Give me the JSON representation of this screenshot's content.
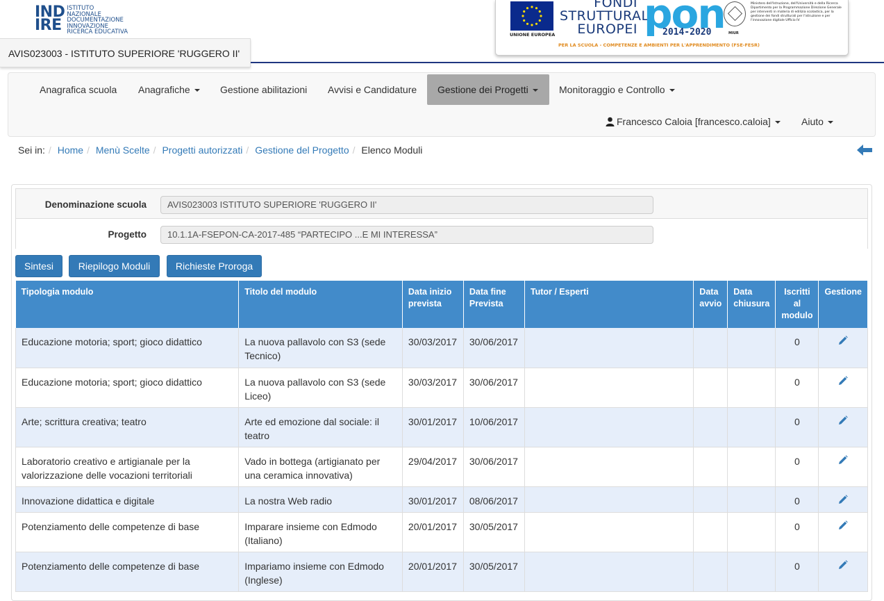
{
  "header": {
    "indire_mark_line1": "IND",
    "indire_mark_line2": "IRE",
    "indire_text": [
      "ISTITUTO",
      "NAZIONALE",
      "DOCUMENTAZIONE",
      "INNOVAZIONE",
      "RICERCA EDUCATIVA"
    ],
    "school_code_title": "AVIS023003 - ISTITUTO SUPERIORE 'RUGGERO II'",
    "eu_label": "UNIONE EUROPEA",
    "fondi_line1": "FONDI",
    "fondi_line2": "STRUTTURALI",
    "fondi_line3": "EUROPEI",
    "pon_word": "pon",
    "pon_years": "2014-2020",
    "miur_label": "MIUR",
    "miur_text": "Ministero dell'Istruzione, dell'Università e della Ricerca Dipartimento per la Programmazione Direzione Generale per interventi in materia di edilizia scolastica, per la gestione dei fondi strutturali per l'istruzione e per l'innovazione digitale Ufficio IV",
    "pon_footer": "PER LA SCUOLA - COMPETENZE E AMBIENTI PER L'APPRENDIMENTO (FSE-FESR)",
    "accent_color": "#1f3680"
  },
  "navbar": {
    "items": [
      {
        "label": "Anagrafica scuola",
        "dropdown": false
      },
      {
        "label": "Anagrafiche",
        "dropdown": true
      },
      {
        "label": "Gestione abilitazioni",
        "dropdown": false
      },
      {
        "label": "Avvisi e Candidature",
        "dropdown": false
      },
      {
        "label": "Gestione dei Progetti",
        "dropdown": true,
        "active": true
      },
      {
        "label": "Monitoraggio e Controllo",
        "dropdown": true
      }
    ],
    "user": "Francesco Caloia [francesco.caloia]",
    "help": "Aiuto"
  },
  "breadcrumb": {
    "prefix": "Sei in:",
    "links": [
      "Home",
      "Menù Scelte",
      "Progetti autorizzati",
      "Gestione del Progetto"
    ],
    "current": "Elenco Moduli"
  },
  "form": {
    "school_label": "Denominazione scuola",
    "school_value": "AVIS023003 ISTITUTO SUPERIORE 'RUGGERO II'",
    "project_label": "Progetto",
    "project_value": "10.1.1A-FSEPON-CA-2017-485 “PARTECIPO ...E MI INTERESSA”"
  },
  "buttons": {
    "sintesi": "Sintesi",
    "riepilogo": "Riepilogo Moduli",
    "proroga": "Richieste Proroga"
  },
  "table": {
    "columns": [
      "Tipologia modulo",
      "Titolo del modulo",
      "Data inizio prevista",
      "Data fine Prevista",
      "Tutor / Esperti",
      "Data avvio",
      "Data chiusura",
      "Iscritti al modulo",
      "Gestione"
    ],
    "rows": [
      {
        "tipologia": "Educazione motoria; sport; gioco didattico",
        "titolo": "La nuova pallavolo con S3 (sede Tecnico)",
        "inizio": "30/03/2017",
        "fine": "30/06/2017",
        "tutor": "",
        "avvio": "",
        "chiusura": "",
        "iscritti": "0"
      },
      {
        "tipologia": "Educazione motoria; sport; gioco didattico",
        "titolo": "La nuova pallavolo con S3 (sede Liceo)",
        "inizio": "30/03/2017",
        "fine": "30/06/2017",
        "tutor": "",
        "avvio": "",
        "chiusura": "",
        "iscritti": "0"
      },
      {
        "tipologia": "Arte; scrittura creativa; teatro",
        "titolo": "Arte ed emozione dal sociale: il teatro",
        "inizio": "30/01/2017",
        "fine": "10/06/2017",
        "tutor": "",
        "avvio": "",
        "chiusura": "",
        "iscritti": "0"
      },
      {
        "tipologia": "Laboratorio creativo e artigianale per la valorizzazione delle vocazioni territoriali",
        "titolo": "Vado in bottega (artigianato per una ceramica innovativa)",
        "inizio": "29/04/2017",
        "fine": "30/06/2017",
        "tutor": "",
        "avvio": "",
        "chiusura": "",
        "iscritti": "0"
      },
      {
        "tipologia": "Innovazione didattica e digitale",
        "titolo": "La nostra Web radio",
        "inizio": "30/01/2017",
        "fine": "08/06/2017",
        "tutor": "",
        "avvio": "",
        "chiusura": "",
        "iscritti": "0"
      },
      {
        "tipologia": "Potenziamento delle competenze di base",
        "titolo": "Imparare insieme con Edmodo (Italiano)",
        "inizio": "20/01/2017",
        "fine": "30/05/2017",
        "tutor": "",
        "avvio": "",
        "chiusura": "",
        "iscritti": "0"
      },
      {
        "tipologia": "Potenziamento delle competenze di base",
        "titolo": "Impariamo insieme con Edmodo (Inglese)",
        "inizio": "20/01/2017",
        "fine": "30/05/2017",
        "tutor": "",
        "avvio": "",
        "chiusura": "",
        "iscritti": "0"
      }
    ]
  },
  "icons": {
    "edit": "pencil-icon",
    "back": "arrow-left-icon",
    "user": "user-icon"
  }
}
